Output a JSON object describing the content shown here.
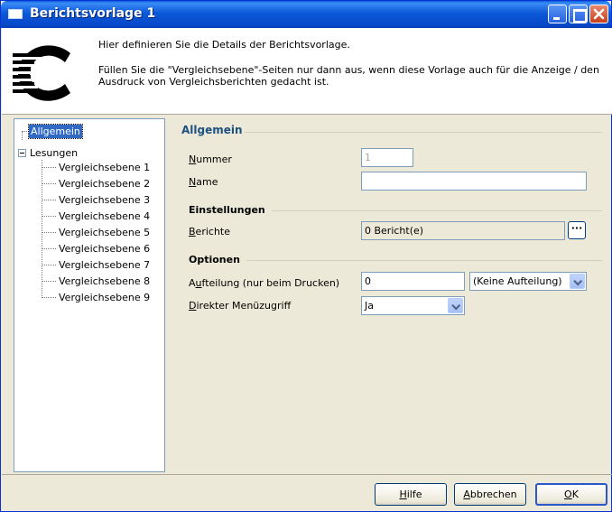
{
  "window": {
    "title": "Berichtsvorlage 1"
  },
  "header": {
    "line1": "Hier definieren Sie die Details der Berichtsvorlage.",
    "line2": "Füllen Sie die \"Vergleichsebene\"-Seiten nur dann aus, wenn diese Vorlage auch für die Anzeige / den Ausdruck von Vergleichsberichten gedacht ist."
  },
  "tree": {
    "root": "Allgemein",
    "parent": "Lesungen",
    "children": [
      "Vergleichsebene 1",
      "Vergleichsebene 2",
      "Vergleichsebene 3",
      "Vergleichsebene 4",
      "Vergleichsebene 5",
      "Vergleichsebene 6",
      "Vergleichsebene 7",
      "Vergleichsebene 8",
      "Vergleichsebene 9"
    ]
  },
  "form": {
    "section_allgemein": "Allgemein",
    "nummer_label": "Nummer",
    "nummer_value": "1",
    "name_label": "Name",
    "name_value": "",
    "section_einstellungen": "Einstellungen",
    "berichte_label": "Berichte",
    "berichte_value": "0 Bericht(e)",
    "berichte_button": "···",
    "section_optionen": "Optionen",
    "aufteilung_label": "Aufteilung (nur beim Drucken)",
    "aufteilung_value": "0",
    "aufteilung_select": "(Keine Aufteilung)",
    "menu_label": "Direkter Menüzugriff",
    "menu_value": "Ja"
  },
  "buttons": {
    "help": "Hilfe",
    "cancel": "Abbrechen",
    "ok": "OK"
  },
  "colors": {
    "title_bar": "#0a5fd8",
    "selection": "#316ac5",
    "section_title": "#1c5180"
  }
}
